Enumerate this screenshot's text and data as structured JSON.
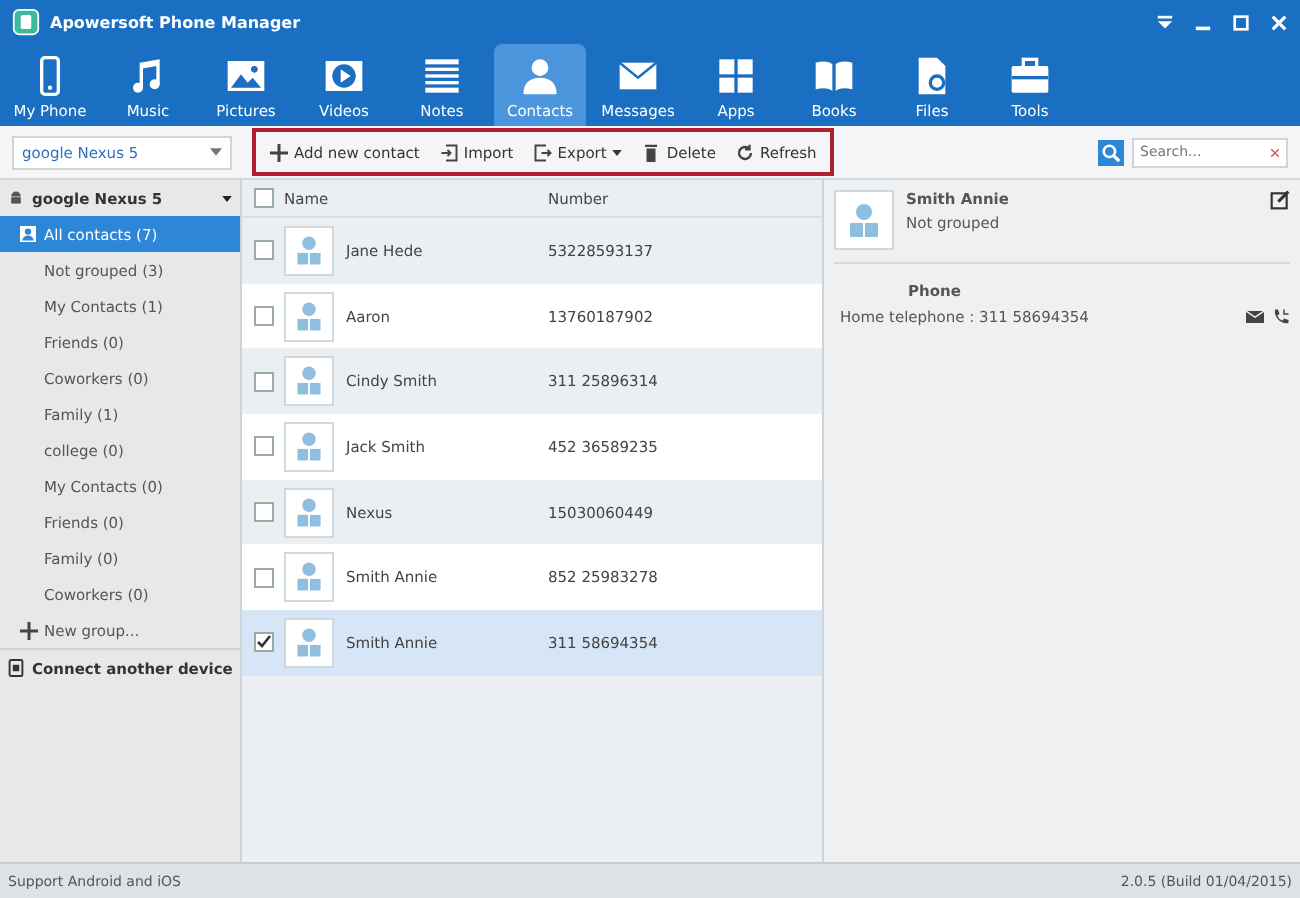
{
  "window": {
    "title": "Apowersoft Phone Manager"
  },
  "nav": [
    {
      "label": "My Phone",
      "selected": false
    },
    {
      "label": "Music",
      "selected": false
    },
    {
      "label": "Pictures",
      "selected": false
    },
    {
      "label": "Videos",
      "selected": false
    },
    {
      "label": "Notes",
      "selected": false
    },
    {
      "label": "Contacts",
      "selected": true
    },
    {
      "label": "Messages",
      "selected": false
    },
    {
      "label": "Apps",
      "selected": false
    },
    {
      "label": "Books",
      "selected": false
    },
    {
      "label": "Files",
      "selected": false
    },
    {
      "label": "Tools",
      "selected": false
    }
  ],
  "device_select": {
    "value": "google Nexus 5"
  },
  "toolbar": [
    {
      "label": "Add new contact"
    },
    {
      "label": "Import"
    },
    {
      "label": "Export"
    },
    {
      "label": "Delete"
    },
    {
      "label": "Refresh"
    }
  ],
  "search": {
    "placeholder": "Search..."
  },
  "sidebar": {
    "device": "google Nexus 5",
    "groups": [
      {
        "label": "All contacts (7)",
        "selected": true
      },
      {
        "label": "Not grouped (3)",
        "selected": false
      },
      {
        "label": "My Contacts (1)",
        "selected": false
      },
      {
        "label": "Friends (0)",
        "selected": false
      },
      {
        "label": "Coworkers (0)",
        "selected": false
      },
      {
        "label": "Family (1)",
        "selected": false
      },
      {
        "label": "college (0)",
        "selected": false
      },
      {
        "label": "My Contacts (0)",
        "selected": false
      },
      {
        "label": "Friends (0)",
        "selected": false
      },
      {
        "label": "Family (0)",
        "selected": false
      },
      {
        "label": "Coworkers (0)",
        "selected": false
      }
    ],
    "new_group": "New group...",
    "connect": "Connect another device"
  },
  "table": {
    "columns": [
      "Name",
      "Number"
    ],
    "header_checked": false,
    "rows": [
      {
        "name": "Jane Hede",
        "number": "53228593137",
        "checked": false,
        "selected": false
      },
      {
        "name": "Aaron",
        "number": "13760187902",
        "checked": false,
        "selected": false
      },
      {
        "name": "Cindy Smith",
        "number": "311 25896314",
        "checked": false,
        "selected": false
      },
      {
        "name": "Jack Smith",
        "number": "452 36589235",
        "checked": false,
        "selected": false
      },
      {
        "name": "Nexus",
        "number": "15030060449",
        "checked": false,
        "selected": false
      },
      {
        "name": "Smith Annie",
        "number": "852 25983278",
        "checked": false,
        "selected": false
      },
      {
        "name": "Smith Annie",
        "number": "311 58694354",
        "checked": true,
        "selected": true
      }
    ]
  },
  "detail": {
    "name": "Smith Annie",
    "group": "Not grouped",
    "section": "Phone",
    "phone": "Home telephone : 311 58694354"
  },
  "status_bar": {
    "left": "Support Android and iOS",
    "right": "2.0.5 (Build 01/04/2015)"
  }
}
